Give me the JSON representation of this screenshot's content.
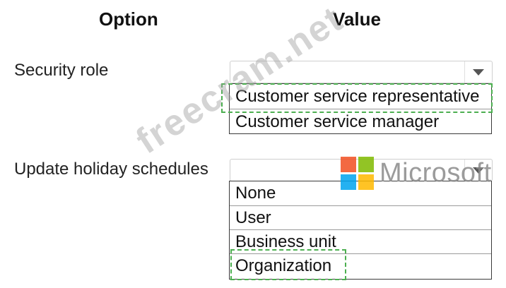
{
  "headers": {
    "option": "Option",
    "value": "Value"
  },
  "rows": [
    {
      "label": "Security role",
      "options": [
        "Customer service representative",
        "Customer service manager"
      ],
      "selected": "Customer service representative"
    },
    {
      "label": "Update holiday schedules",
      "options": [
        "None",
        "User",
        "Business unit",
        "Organization"
      ],
      "selected": "Organization"
    }
  ],
  "watermark": "freecram.net",
  "logo": {
    "text": "Microsoft",
    "colors": [
      "#f25022",
      "#7fba00",
      "#00a4ef",
      "#ffb900"
    ]
  },
  "selection_color": "#4caf50"
}
